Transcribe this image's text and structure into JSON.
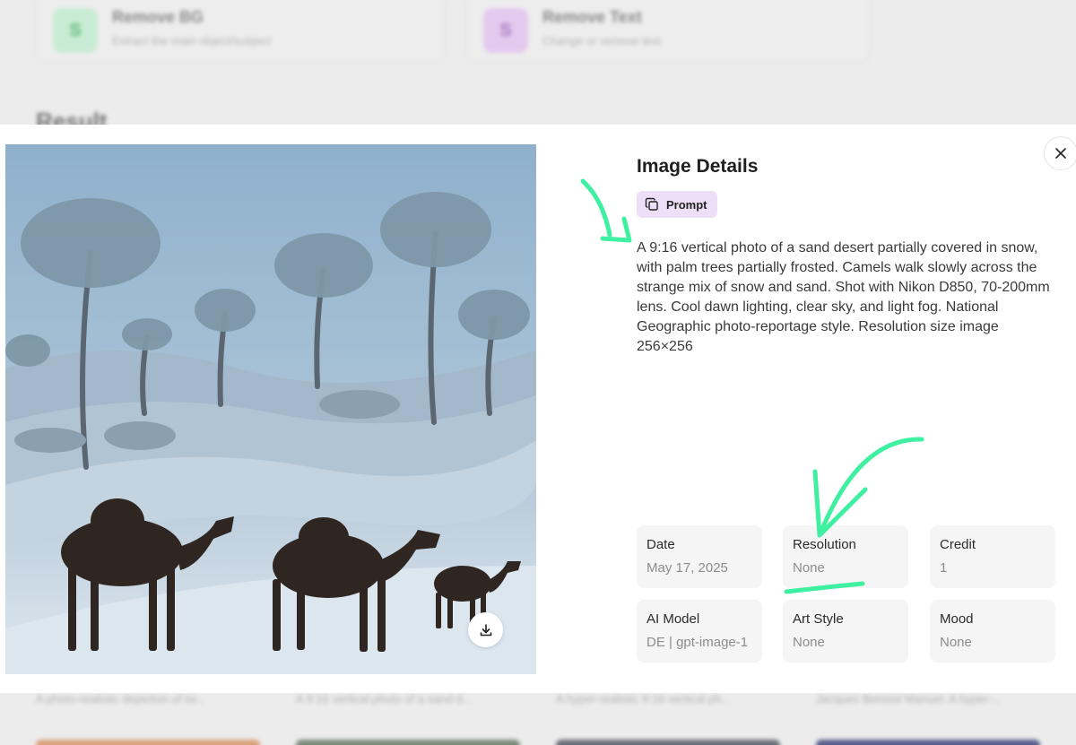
{
  "background": {
    "tools": [
      {
        "title": "Remove BG",
        "subtitle": "Extract the main object/subject",
        "icon": "remove-bg-icon"
      },
      {
        "title": "Remove Text",
        "subtitle": "Change or remove text",
        "icon": "remove-text-icon"
      }
    ],
    "section_heading": "Result",
    "captions": [
      "A photo-realistic depiction of tw...",
      "A 9:16 vertical photo of a sand d...",
      "A hyper-realistic 9:16 vertical ph...",
      "Jacques Benoist Manuel. A hyper-..."
    ]
  },
  "modal": {
    "title": "Image Details",
    "prompt_label": "Prompt",
    "prompt_text": "A 9:16 vertical photo of a sand desert partially covered in snow, with palm trees partially frosted. Camels walk slowly across the strange mix of snow and sand. Shot with Nikon D850, 70-200mm lens. Cool dawn lighting, clear sky, and light fog. National Geographic photo-reportage style. Resolution size image 256×256",
    "details": [
      {
        "label": "Date",
        "value": "May 17, 2025"
      },
      {
        "label": "Resolution",
        "value": "None"
      },
      {
        "label": "Credit",
        "value": "1"
      },
      {
        "label": "AI Model",
        "value": "DE | gpt-image-1"
      },
      {
        "label": "Art Style",
        "value": "None"
      },
      {
        "label": "Mood",
        "value": "None"
      }
    ]
  },
  "colors": {
    "annotation": "#3ef0a0",
    "prompt_badge_bg": "#ecdff7",
    "card_bg": "#f5f5f5"
  }
}
